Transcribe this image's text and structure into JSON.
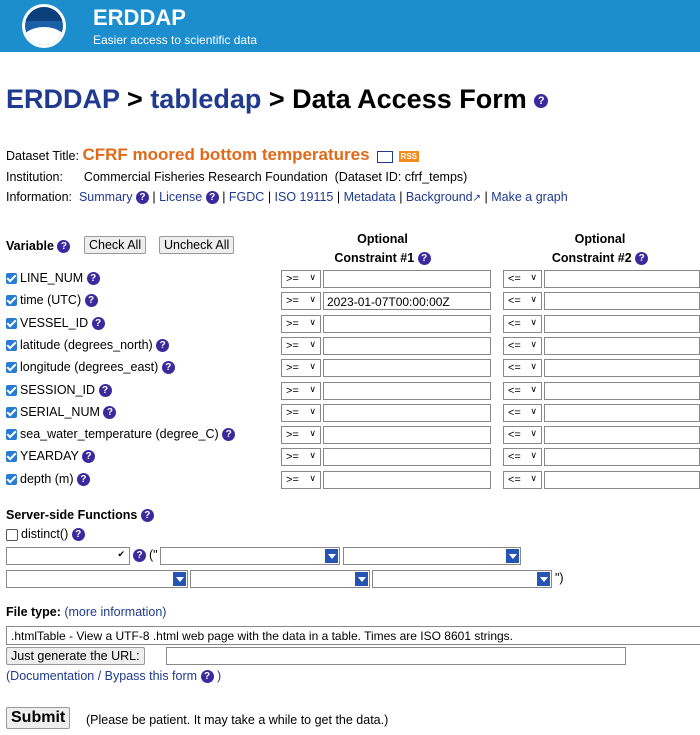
{
  "banner": {
    "title": "ERDDAP",
    "subtitle": "Easier access to scientific data"
  },
  "heading": {
    "part1": "ERDDAP",
    "sep1": " > ",
    "part2": "tabledap",
    "sep2": " > ",
    "part3": "Data Access Form"
  },
  "dataset": {
    "title_label": "Dataset Title:",
    "title": "CFRF moored bottom temperatures",
    "rss": "RSS",
    "institution_label": "Institution:",
    "institution": "Commercial Fisheries Research Foundation",
    "dataset_id": "(Dataset ID: cfrf_temps)",
    "information_label": "Information:",
    "links": {
      "summary": "Summary",
      "license": "License",
      "fgdc": "FGDC",
      "iso": "ISO 19115",
      "metadata": "Metadata",
      "background": "Background",
      "graph": "Make a graph"
    }
  },
  "table": {
    "variable_header": "Variable",
    "check_all": "Check All",
    "uncheck_all": "Uncheck All",
    "constraint1_header": [
      "Optional",
      "Constraint #1"
    ],
    "constraint2_header": [
      "Optional",
      "Constraint #2"
    ],
    "rows": [
      {
        "name": "LINE_NUM",
        "op1": ">=",
        "val1": "",
        "op2": "<="
      },
      {
        "name": "time (UTC)",
        "op1": ">=",
        "val1": "2023-01-07T00:00:00Z",
        "op2": "<="
      },
      {
        "name": "VESSEL_ID",
        "op1": ">=",
        "val1": "",
        "op2": "<="
      },
      {
        "name": "latitude (degrees_north)",
        "op1": ">=",
        "val1": "",
        "op2": "<="
      },
      {
        "name": "longitude (degrees_east)",
        "op1": ">=",
        "val1": "",
        "op2": "<="
      },
      {
        "name": "SESSION_ID",
        "op1": ">=",
        "val1": "",
        "op2": "<="
      },
      {
        "name": "SERIAL_NUM",
        "op1": ">=",
        "val1": "",
        "op2": "<="
      },
      {
        "name": "sea_water_temperature (degree_C)",
        "op1": ">=",
        "val1": "",
        "op2": "<="
      },
      {
        "name": "YEARDAY",
        "op1": ">=",
        "val1": "",
        "op2": "<="
      },
      {
        "name": "depth (m)",
        "op1": ">=",
        "val1": "",
        "op2": "<="
      }
    ]
  },
  "server_side": {
    "heading": "Server-side Functions",
    "distinct": "distinct()",
    "open_paren": "(\"",
    "close_paren": "\")"
  },
  "file_type": {
    "label": "File type:",
    "more_info": "(more information)",
    "selected": ".htmlTable - View a UTF-8 .html web page with the data in a table. Times are ISO 8601 strings.",
    "just_url": "Just generate the URL:",
    "doc_link": "(Documentation / Bypass this form",
    "doc_close": ")"
  },
  "submit": {
    "label": "Submit",
    "note": "(Please be patient. It may take a while to get the data.)"
  },
  "colors": {
    "banner": "#1c8dcd",
    "link": "#1f3a8f",
    "title": "#e06a1a"
  }
}
